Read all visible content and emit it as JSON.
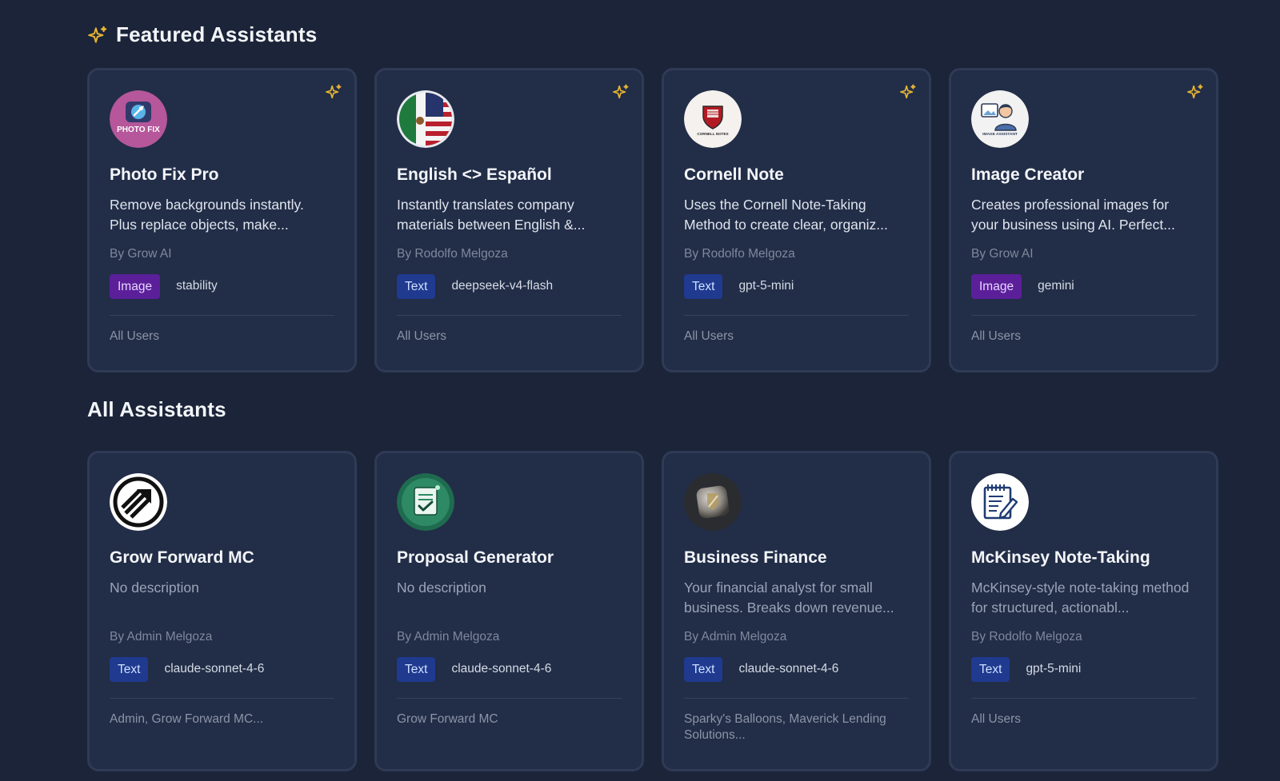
{
  "featured": {
    "title": "Featured Assistants",
    "cards": [
      {
        "name": "Photo Fix Pro",
        "description": "Remove backgrounds instantly. Plus replace objects, make...",
        "author": "By Grow AI",
        "type": "Image",
        "model": "stability",
        "audience": "All Users",
        "avatar_text": "PHOTO FIX"
      },
      {
        "name": "English <> Español",
        "description": "Instantly translates company materials between English &...",
        "author": "By Rodolfo Melgoza",
        "type": "Text",
        "model": "deepseek-v4-flash",
        "audience": "All Users"
      },
      {
        "name": "Cornell Note",
        "description": "Uses the Cornell Note-Taking Method to create clear, organiz...",
        "author": "By Rodolfo Melgoza",
        "type": "Text",
        "model": "gpt-5-mini",
        "audience": "All Users",
        "avatar_text": "CORNELL NOTES"
      },
      {
        "name": "Image Creator",
        "description": "Creates professional images for your business using AI. Perfect...",
        "author": "By Grow AI",
        "type": "Image",
        "model": "gemini",
        "audience": "All Users",
        "avatar_text": "IMAGE ASSISTANT"
      }
    ]
  },
  "all": {
    "title": "All Assistants",
    "cards": [
      {
        "name": "Grow Forward MC",
        "description": "No description",
        "author": "By Admin Melgoza",
        "type": "Text",
        "model": "claude-sonnet-4-6",
        "audience": "Admin, Grow Forward MC..."
      },
      {
        "name": "Proposal Generator",
        "description": "No description",
        "author": "By Admin Melgoza",
        "type": "Text",
        "model": "claude-sonnet-4-6",
        "audience": "Grow Forward MC"
      },
      {
        "name": "Business Finance",
        "description": "Your financial analyst for small business. Breaks down revenue...",
        "author": "By Admin Melgoza",
        "type": "Text",
        "model": "claude-sonnet-4-6",
        "audience": "Sparky's Balloons, Maverick Lending Solutions..."
      },
      {
        "name": "McKinsey Note-Taking",
        "description": "McKinsey-style note-taking method for structured, actionabl...",
        "author": "By Rodolfo Melgoza",
        "type": "Text",
        "model": "gpt-5-mini",
        "audience": "All Users"
      }
    ]
  },
  "icons": {
    "featured_marker": "sparkle-icon",
    "pin": "sparkle-icon"
  },
  "colors": {
    "background": "#1b2438",
    "card": "#222d47",
    "accent_gold": "#e7b532",
    "image_badge": "#5b1f9a",
    "text_badge": "#1f3a8f"
  }
}
